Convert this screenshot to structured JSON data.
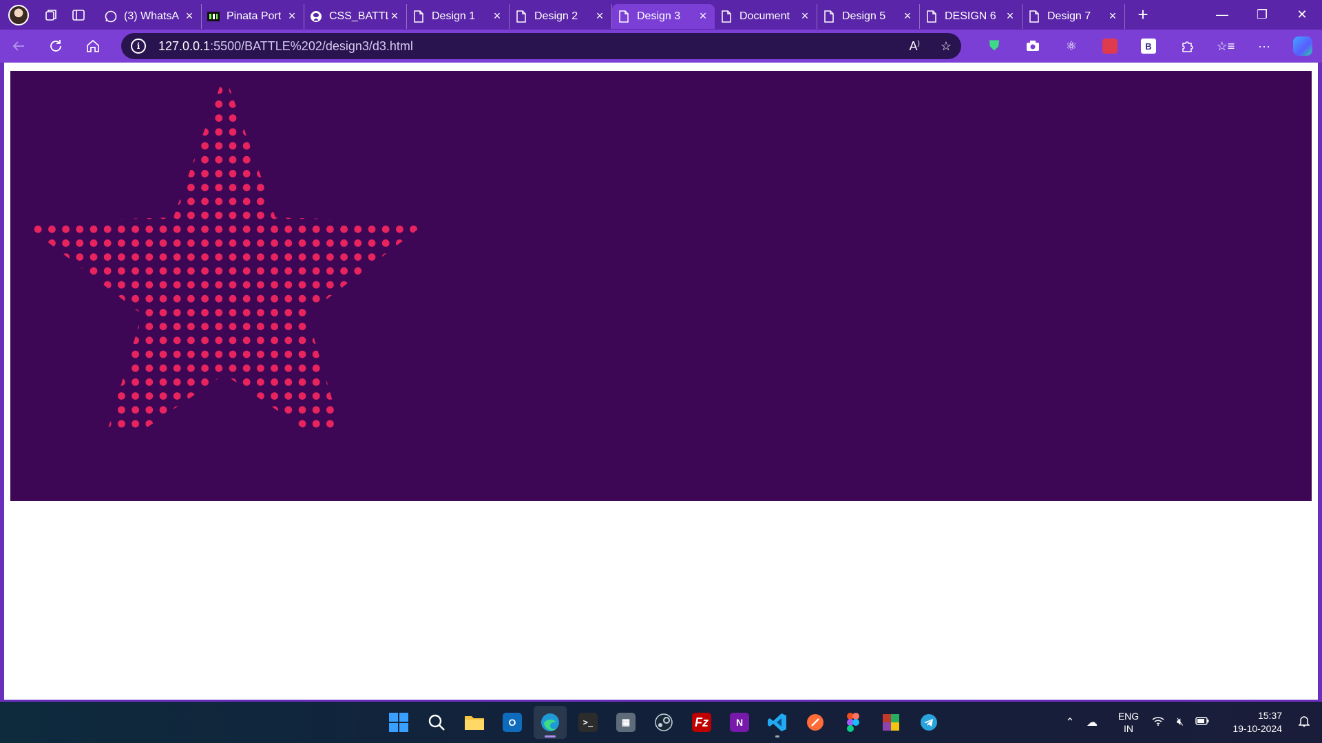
{
  "browser": {
    "tabs": [
      {
        "title": "(3) WhatsA",
        "icon": "whatsapp-icon",
        "active": false
      },
      {
        "title": "Pinata Port",
        "icon": "pinata-icon",
        "active": false
      },
      {
        "title": "CSS_BATTL",
        "icon": "github-icon",
        "active": false
      },
      {
        "title": "Design 1",
        "icon": "page-icon",
        "active": false
      },
      {
        "title": "Design 2",
        "icon": "page-icon",
        "active": false
      },
      {
        "title": "Design 3",
        "icon": "page-icon",
        "active": true
      },
      {
        "title": "Document",
        "icon": "page-icon",
        "active": false
      },
      {
        "title": "Design 5",
        "icon": "page-icon",
        "active": false
      },
      {
        "title": "DESIGN 6",
        "icon": "page-icon",
        "active": false
      },
      {
        "title": "Design 7",
        "icon": "page-icon",
        "active": false
      }
    ],
    "address": {
      "host": "127.0.0.1",
      "path": ":5500/BATTLE%202/design3/d3.html"
    },
    "colors": {
      "tab_strip": "#5a25a8",
      "toolbar": "#7b3fd6"
    }
  },
  "page": {
    "background": "#3d0755",
    "dot_color": "#e8245f",
    "shape": "star"
  },
  "taskbar": {
    "apps": [
      "start",
      "search",
      "file-explorer",
      "outlook",
      "edge",
      "terminal",
      "calculator",
      "steam",
      "filezilla",
      "onenote",
      "vscode",
      "postman",
      "figma",
      "winrar",
      "telegram"
    ],
    "lang_primary": "ENG",
    "lang_secondary": "IN",
    "time": "15:37",
    "date": "19-10-2024"
  }
}
